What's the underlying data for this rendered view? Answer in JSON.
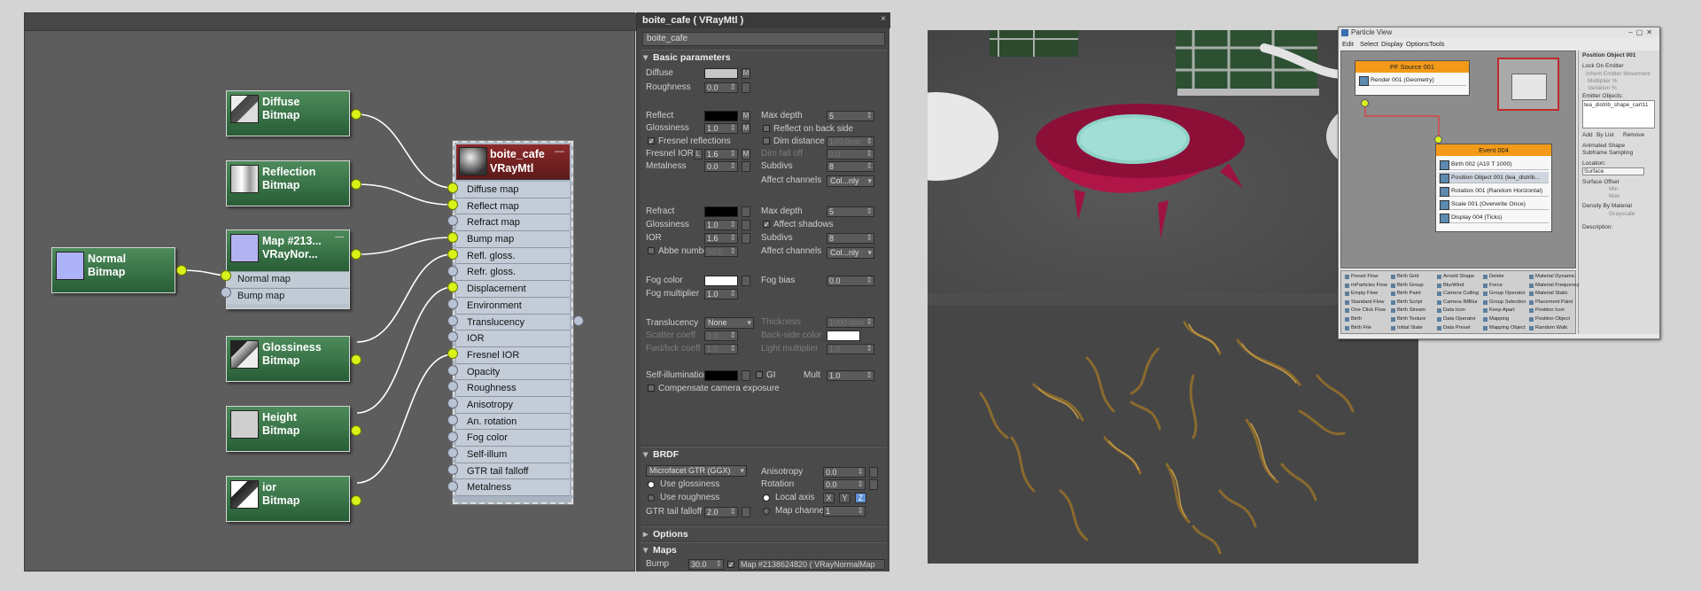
{
  "slate": {
    "nodes": {
      "diffuse": {
        "title": "Diffuse",
        "sub": "Bitmap"
      },
      "reflection": {
        "title": "Reflection",
        "sub": "Bitmap"
      },
      "normalmap": {
        "title": "Map #213...",
        "sub": "VRayNor...",
        "slots": [
          "Normal map",
          "Bump map"
        ]
      },
      "normal": {
        "title": "Normal",
        "sub": "Bitmap"
      },
      "glossiness": {
        "title": "Glossiness",
        "sub": "Bitmap"
      },
      "height": {
        "title": "Height",
        "sub": "Bitmap"
      },
      "ior": {
        "title": "ior",
        "sub": "Bitmap"
      }
    },
    "material": {
      "title": "boite_cafe",
      "sub": "VRayMtl",
      "close": "—",
      "slots": [
        "Diffuse map",
        "Reflect map",
        "Refract map",
        "Bump map",
        "Refl. gloss.",
        "Refr. gloss.",
        "Displacement",
        "Environment",
        "Translucency",
        "IOR",
        "Fresnel IOR",
        "Opacity",
        "Roughness",
        "Anisotropy",
        "An. rotation",
        "Fog color",
        "Self-illum",
        "GTR tail falloff",
        "Metalness"
      ]
    }
  },
  "params": {
    "title": "boite_cafe  ( VRayMtl )",
    "close": "×",
    "name": "boite_cafe",
    "basic": {
      "head": "Basic parameters",
      "diffuse": "Diffuse",
      "roughness": "Roughness",
      "roughness_val": "0.0",
      "m": "M",
      "reflect": "Reflect",
      "glossiness": "Glossiness",
      "glossiness_val": "1.0",
      "fresnel": "Fresnel reflections",
      "fresnel_ior": "Fresnel IOR",
      "fresnel_ior_l": "L",
      "fresnel_ior_val": "1.6",
      "metalness": "Metalness",
      "metalness_val": "0.0",
      "max_depth": "Max depth",
      "max_depth_val": "5",
      "reflect_back": "Reflect on back side",
      "dim_distance": "Dim distance",
      "dim_distance_val": "100.0cm",
      "dim_falloff": "Dim fall off",
      "dim_falloff_val": "0.0",
      "subdivs": "Subdivs",
      "subdivs_val": "8",
      "affect_channels": "Affect channels",
      "affect_channels_val": "Col...nly",
      "refract": "Refract",
      "r_glossiness": "Glossiness",
      "r_glossiness_val": "1.0",
      "ior": "IOR",
      "ior_val": "1.6",
      "abbe": "Abbe number",
      "abbe_val": "50.0",
      "r_max_depth": "Max depth",
      "r_max_depth_val": "5",
      "affect_shadows": "Affect shadows",
      "r_subdivs": "Subdivs",
      "r_subdivs_val": "8",
      "r_affect_channels": "Affect channels",
      "r_affect_channels_val": "Col...nly",
      "fog_color": "Fog color",
      "fog_bias": "Fog bias",
      "fog_bias_val": "0.0",
      "fog_mult": "Fog multiplier",
      "fog_mult_val": "1.0",
      "translucency": "Translucency",
      "translucency_val": "None",
      "thickness": "Thickness",
      "thickness_val": "1000.0cm",
      "scatter": "Scatter coeff",
      "scatter_val": "0.0",
      "backside": "Back-side color",
      "fwd": "Fwd/bck coeff",
      "fwd_val": "1.0",
      "light_mult": "Light multiplier",
      "light_mult_val": "1.0",
      "self_illum": "Self-illumination",
      "gi": "GI",
      "mult": "Mult",
      "mult_val": "1.0",
      "compensate": "Compensate camera exposure"
    },
    "brdf": {
      "head": "BRDF",
      "type": "Microfacet GTR (GGX)",
      "use_glossiness": "Use glossiness",
      "use_roughness": "Use roughness",
      "gtr": "GTR tail falloff",
      "gtr_val": "2.0",
      "anisotropy": "Anisotropy",
      "anisotropy_val": "0.0",
      "rotation": "Rotation",
      "rotation_val": "0.0",
      "local_axis": "Local axis",
      "x": "X",
      "y": "Y",
      "z": "Z",
      "map_channel": "Map channel",
      "map_channel_val": "1"
    },
    "options": {
      "head": "Options"
    },
    "maps": {
      "head": "Maps",
      "bump": "Bump",
      "bump_val": "30.0",
      "bump_map": "Map #2138624820  ( VRayNormalMap"
    }
  },
  "particle_view": {
    "title": "Particle View",
    "menu": [
      "Edit",
      "Select",
      "Display",
      "Options",
      "Tools"
    ],
    "pf_source": {
      "head": "PF Source 001",
      "op": "Render 001 (Geometry)"
    },
    "event": {
      "head": "Event 004",
      "ops": [
        "Birth 002 (A10 T 1000)",
        "Position Object 001 (tea_distrib...",
        "Rotation 001 (Random Horizontal)",
        "Scale 001 (Overwrite Once)",
        "Display 004 (Ticks)"
      ]
    },
    "panel": {
      "head": "Position Object 001",
      "lock": "Lock On Emitter",
      "inherit": "Inherit Emitter Movement",
      "multiplier": "Multiplier %",
      "variation": "Variation %",
      "emitter_objects": "Emitter Objects:",
      "emitter_item": "tea_distrib_shape_cart11",
      "add": "Add",
      "by_list": "By List",
      "remove": "Remove",
      "animated": "Animated Shape",
      "subframe": "Subframe Sampling",
      "location": "Location:",
      "location_val": "Surface",
      "surface_offset": "Surface Offset",
      "min": "Min",
      "max": "Max",
      "density": "Density By Material",
      "grayscale": "Grayscale",
      "description": "Description:"
    },
    "depot": [
      [
        "Preset Flow",
        "mParticles Flow",
        "Empty Flow",
        "Standard Flow",
        "One Click Flow",
        "Birth",
        "Birth File"
      ],
      [
        "Birth Grid",
        "Birth Group",
        "Birth Paint",
        "Birth Script",
        "Birth Stream",
        "Birth Texture",
        "Initial State"
      ],
      [
        "Arnold Shape",
        "BlurWind",
        "Camera Culling",
        "Camera IMBlur",
        "Data Icon",
        "Data Operator",
        "Data Preset"
      ],
      [
        "Delete",
        "Force",
        "Group Operator",
        "Group Selection",
        "Keep Apart",
        "Mapping",
        "Mapping Object"
      ],
      [
        "Material Dynamic",
        "Material Frequency",
        "Material Static",
        "Placement Paint",
        "Position Icon",
        "Position Object",
        "Random Walk"
      ]
    ]
  },
  "colors": {
    "node_green": "#2f6e3e",
    "material_red": "#7a2020",
    "socket_yellow": "#d9f21a",
    "pf_orange": "#f39a18",
    "bowl_magenta": "#b01547"
  }
}
